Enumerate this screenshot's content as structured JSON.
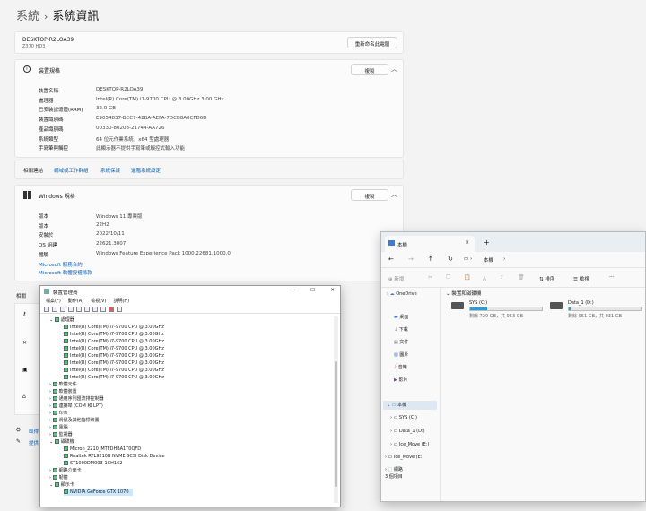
{
  "breadcrumb": {
    "parent": "系統",
    "separator": "›",
    "current": "系統資訊"
  },
  "device": {
    "name": "DESKTOP-R2LOA39",
    "model": "Z370 HD3",
    "rename_label": "重新命名此電腦"
  },
  "specs": {
    "title": "裝置規格",
    "copy_label": "複製",
    "rows": [
      {
        "k": "裝置名稱",
        "v": "DESKTOP-R2LOA39"
      },
      {
        "k": "處理器",
        "v": "Intel(R) Core(TM) i7-9700 CPU @ 3.00GHz   3.00 GHz"
      },
      {
        "k": "已安裝記憶體(RAM)",
        "v": "32.0 GB"
      },
      {
        "k": "裝置識別碼",
        "v": "E9054837-BCC7-42BA-AEFA-7DCB8A0CFD6D"
      },
      {
        "k": "產品識別碼",
        "v": "00330-80208-21744-AA726"
      },
      {
        "k": "系統類型",
        "v": "64 位元作業系統，x64 型處理器"
      },
      {
        "k": "手寫筆與觸控",
        "v": "此顯示器不提供手寫筆或觸控式輸入功能"
      }
    ]
  },
  "related": {
    "label": "相關連結",
    "links": [
      "網域或工作群組",
      "系統保護",
      "進階系統設定"
    ]
  },
  "windows": {
    "title": "Windows 規格",
    "copy_label": "複製",
    "rows": [
      {
        "k": "版本",
        "v": "Windows 11 專業版"
      },
      {
        "k": "版本",
        "v": "22H2"
      },
      {
        "k": "安裝於",
        "v": "2022/10/11"
      },
      {
        "k": "OS 組建",
        "v": "22621.3007"
      },
      {
        "k": "體驗",
        "v": "Windows Feature Experience Pack 1000.22681.1000.0"
      }
    ],
    "links": [
      "Microsoft 服務合約",
      "Microsoft 軟體授權條款"
    ]
  },
  "side_labels": {
    "related": "相關",
    "get_help": "取得",
    "feedback": "提供"
  },
  "devmgr": {
    "title": "裝置管理員",
    "menu": [
      "檔案(F)",
      "動作(A)",
      "檢視(V)",
      "說明(H)"
    ],
    "processor_group": "處理器",
    "cpus": [
      "Intel(R) Core(TM) i7-9700 CPU @ 3.00GHz",
      "Intel(R) Core(TM) i7-9700 CPU @ 3.00GHz",
      "Intel(R) Core(TM) i7-9700 CPU @ 3.00GHz",
      "Intel(R) Core(TM) i7-9700 CPU @ 3.00GHz",
      "Intel(R) Core(TM) i7-9700 CPU @ 3.00GHz",
      "Intel(R) Core(TM) i7-9700 CPU @ 3.00GHz",
      "Intel(R) Core(TM) i7-9700 CPU @ 3.00GHz",
      "Intel(R) Core(TM) i7-9700 CPU @ 3.00GHz"
    ],
    "groups1": [
      "軟體元件",
      "軟體裝置",
      "通用序列匯流排控制器",
      "連接埠 (COM 和 LPT)",
      "印表",
      "滑鼠及其他指標裝置",
      "電腦",
      "監視器"
    ],
    "disk_group": "磁碟機",
    "disks": [
      "Micron_2210_MTFDHBA1T0QFD",
      "Realtek RTL9210B NVME SCSI Disk Device",
      "ST1000DM003-1CH162"
    ],
    "groups2": [
      "網路介面卡",
      "韌體"
    ],
    "display_group": "顯示卡",
    "gpu": "NVIDIA GeForce GTX 1070"
  },
  "explorer": {
    "tab": "本機",
    "address": "本機",
    "new_label": "新增",
    "sort_label": "排序",
    "view_label": "檢視",
    "section": "裝置和磁碟機",
    "drives": [
      {
        "name": "SYS (C:)",
        "free": "剩餘 729 GB，共 953 GB",
        "used": 0.235
      },
      {
        "name": "Data_1 (D:)",
        "free": "剩餘 951 GB，共 931 GB",
        "used": 0.02
      }
    ],
    "sidebar": [
      "OneDrive",
      "桌面",
      "下載",
      "文件",
      "圖片",
      "音樂",
      "影片",
      "本機",
      "SYS (C:)",
      "Data_1 (D:)",
      "Ice_Move (E:)",
      "Ice_Move (E:)",
      "網路"
    ],
    "status": "3 個項目"
  }
}
